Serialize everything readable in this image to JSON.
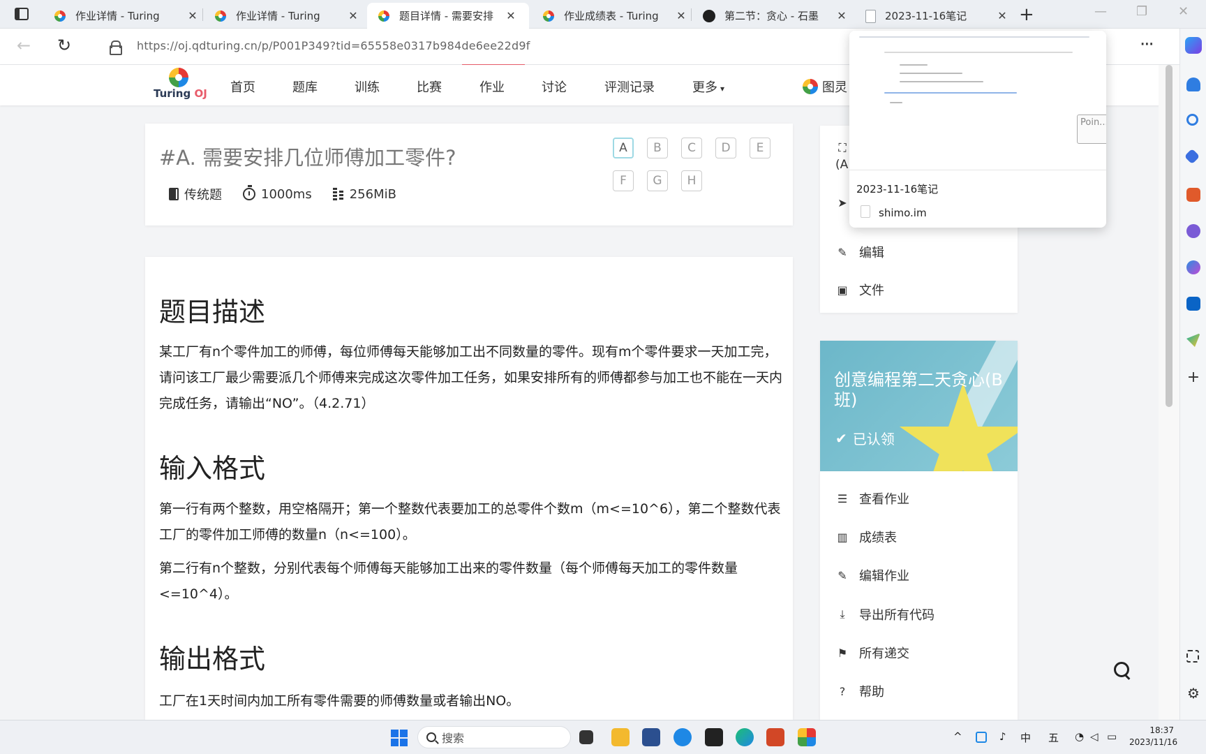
{
  "browser": {
    "tabs": [
      {
        "title": "作业详情 - Turing",
        "active": false
      },
      {
        "title": "作业详情 - Turing",
        "active": false
      },
      {
        "title": "题目详情 - 需要安排",
        "active": true
      },
      {
        "title": "作业成绩表 - Turing",
        "active": false
      },
      {
        "title": "第二节：贪心 - 石墨",
        "active": false
      },
      {
        "title": "2023-11-16笔记",
        "active": false
      }
    ],
    "url": "https://oj.qdturing.cn/p/P001P349?tid=65558e0317b984de6ee22d9f",
    "new_tab_glyph": "+",
    "close_glyph": "✕"
  },
  "site": {
    "logo_text": "Turing",
    "logo_suffix": "OJ",
    "menu": [
      "首页",
      "题库",
      "训练",
      "比赛",
      "作业",
      "讨论",
      "评测记录",
      "更多"
    ],
    "user_label": "图灵"
  },
  "problem": {
    "title": "#A. 需要安排几位师傅加工零件?",
    "type": "传统题",
    "time_limit": "1000ms",
    "memory_limit": "256MiB",
    "letters": [
      "A",
      "B",
      "C",
      "D",
      "E",
      "F",
      "G",
      "H"
    ],
    "active_letter": "A",
    "sections": {
      "desc_heading": "题目描述",
      "desc_text": "某工厂有n个零件加工的师傅，每位师傅每天能够加工出不同数量的零件。现有m个零件要求一天加工完，请问该工厂最少需要派几个师傅来完成这次零件加工任务，如果安排所有的师傅都参与加工也不能在一天内完成任务，请输出“NO”。（4.2.71）",
      "input_heading": "输入格式",
      "input_text_1": "第一行有两个整数，用空格隔开；第一个整数代表要加工的总零件个数m（m<=10^6），第二个整数代表工厂的零件加工师傅的数量n（n<=100）。",
      "input_text_2": "第二行有n个整数，分别代表每个师傅每天能够加工出来的零件数量（每个师傅每天加工的零件数量<=10^4）。",
      "output_heading": "输出格式",
      "output_text": "工厂在1天时间内加工所有零件需要的师傅数量或者输出NO。"
    }
  },
  "side": {
    "top_partial_1": "(A",
    "edit_label": "编辑",
    "file_label": "文件",
    "banner_title": "创意编程第二天贪心(B班)",
    "banner_status": "已认领",
    "actions": [
      "查看作业",
      "成绩表",
      "编辑作业",
      "导出所有代码",
      "所有递交",
      "帮助"
    ]
  },
  "tab_preview": {
    "title": "2023-11-16笔记",
    "host": "shimo.im",
    "pinned_label": "Poin..."
  },
  "taskbar": {
    "search_placeholder": "搜索",
    "ime": "中",
    "ime2": "五",
    "time": "18:37",
    "date": "2023/11/16"
  }
}
